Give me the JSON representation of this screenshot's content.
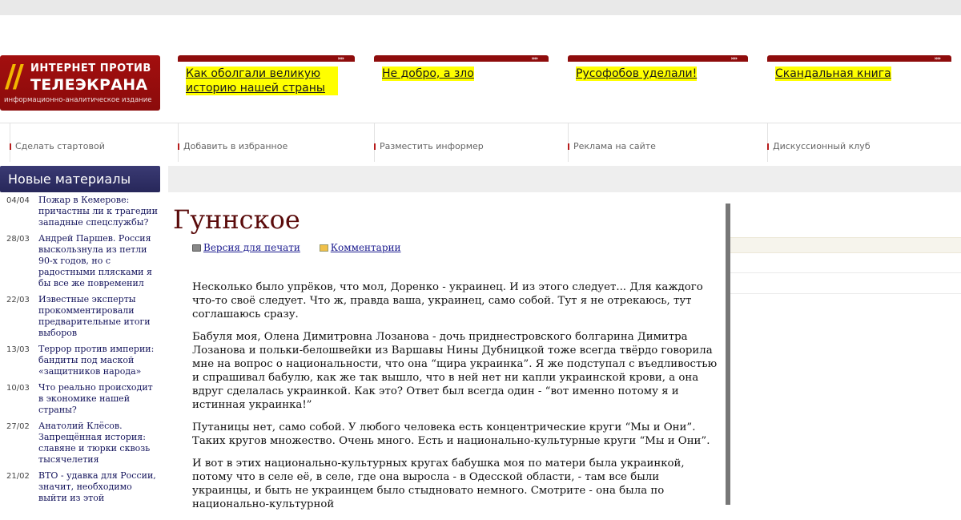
{
  "logo": {
    "slashes": "//",
    "line1": "ИНТЕРНЕТ ПРОТИВ",
    "line2": "ТЕЛЕЭКРАНА",
    "line3": "информационно-аналитическое издание"
  },
  "promos": [
    {
      "arrows": "››››",
      "text": "Как оболгали великую историю нашей страны"
    },
    {
      "arrows": "››››",
      "text": "Не добро, а зло"
    },
    {
      "arrows": "››››",
      "text": "Русофобов уделали!"
    },
    {
      "arrows": "››››",
      "text": "Скандальная книга"
    }
  ],
  "nav": [
    "Сделать стартовой",
    "Добавить в избранное",
    "Разместить информер",
    "Реклама на сайте",
    "Дискуссионный клуб"
  ],
  "sidebar": {
    "title": "Новые материалы",
    "items": [
      {
        "date": "04/04",
        "title": "Пожар в Кемерове: причастны ли к трагедии западные спецслужбы?"
      },
      {
        "date": "28/03",
        "title": "Андрей Паршев. Россия выскользнула из петли 90-х годов, но с радостными плясками я бы все же повременил"
      },
      {
        "date": "22/03",
        "title": "Известные эксперты прокомментировали предварительные итоги выборов"
      },
      {
        "date": "13/03",
        "title": "Террор против империи: бандиты под маской «защитников народа»"
      },
      {
        "date": "10/03",
        "title": "Что реально происходит в экономике нашей страны?"
      },
      {
        "date": "27/02",
        "title": "Анатолий Клёсов. Запрещённая история: славяне и тюрки сквозь тысячелетия"
      },
      {
        "date": "21/02",
        "title": "ВТО - удавка для России, значит, необходимо выйти из этой"
      }
    ]
  },
  "article": {
    "title": "Гуннское",
    "print_label": "Версия для печати",
    "comments_label": "Комментарии",
    "paragraphs": [
      "Несколько было упрёков, что мол, Доренко - украинец. И из этого следует... Для каждого что-то своё следует. Что ж, правда ваша, украинец, само собой. Тут я не отрекаюсь, тут соглашаюсь сразу.",
      "Бабуля моя, Олена Димитровна Лозанова - дочь приднестровского болгарина Димитра Лозанова и польки-белошвейки из Варшавы Нины Дубницкой тоже всегда твёрдо говорила мне на вопрос о национальности, что она “щира украинка”. Я же подступал с въедливостью и спрашивал бабулю, как же так вышло, что в ней нет ни капли украинской крови, а она вдруг сделалась украинкой. Как это? Ответ был всегда один - “вот именно потому я и истинная украинка!”",
      "Путаницы нет, само собой. У любого человека есть концентрические круги “Мы и Они”. Таких кругов множество. Очень много. Есть и национально-культурные круги “Мы и Они”.",
      "И вот в этих национально-культурных кругах бабушка моя по матери была украинкой, потому что в селе её, в селе, где она выросла - в Одесской области, - там все были украинцы, и быть не украинцем было стыдновато немного. Смотрите - она была по национально-культурной"
    ]
  }
}
